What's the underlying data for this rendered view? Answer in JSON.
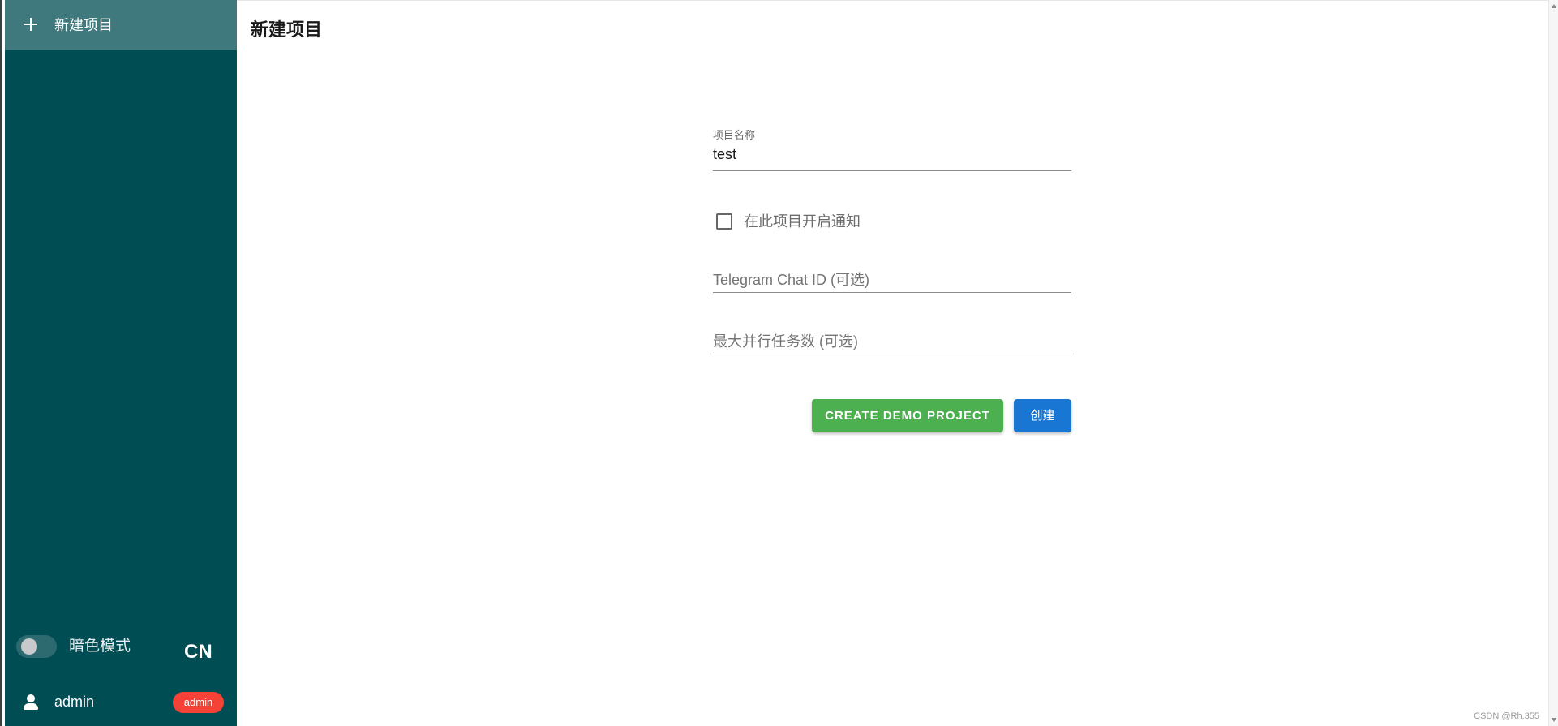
{
  "sidebar": {
    "new_project_label": "新建项目",
    "dark_mode_label": "暗色模式",
    "dark_mode_on": false,
    "language": "CN",
    "user": {
      "name": "admin",
      "role_badge": "admin"
    }
  },
  "main": {
    "title": "新建项目",
    "form": {
      "project_name_label": "项目名称",
      "project_name_value": "test",
      "notify_label": "在此项目开启通知",
      "notify_checked": false,
      "telegram_placeholder": "Telegram Chat ID (可选)",
      "max_parallel_placeholder": "最大并行任务数 (可选)",
      "demo_button": "CREATE DEMO PROJECT",
      "create_button": "创建"
    }
  },
  "watermark": "CSDN @Rh.355",
  "colors": {
    "sidebar_bg": "#004d54",
    "sidebar_active_bg": "#3f787d",
    "demo_button": "#4caf50",
    "create_button": "#1976d2",
    "role_badge": "#f44336"
  }
}
